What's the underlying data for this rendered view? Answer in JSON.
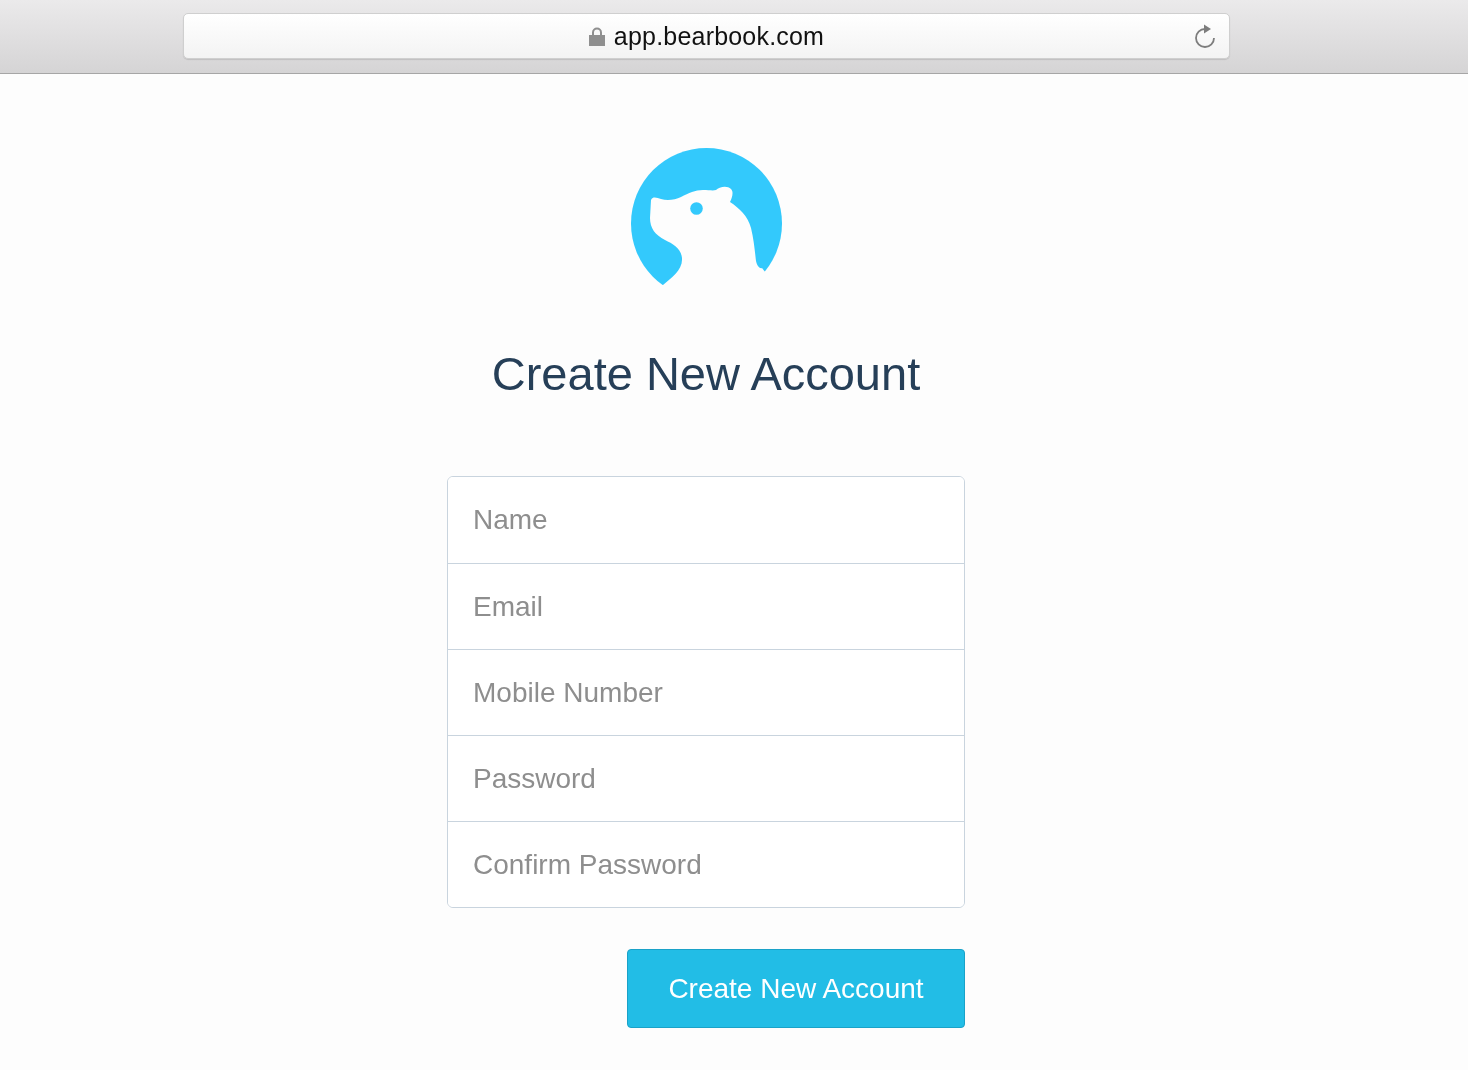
{
  "browser": {
    "url": "app.bearbook.com"
  },
  "title": "Create New Account",
  "form": {
    "fields": [
      {
        "placeholder": "Name"
      },
      {
        "placeholder": "Email"
      },
      {
        "placeholder": "Mobile Number"
      },
      {
        "placeholder": "Password"
      },
      {
        "placeholder": "Confirm Password"
      }
    ]
  },
  "submit_button": "Create New Account"
}
